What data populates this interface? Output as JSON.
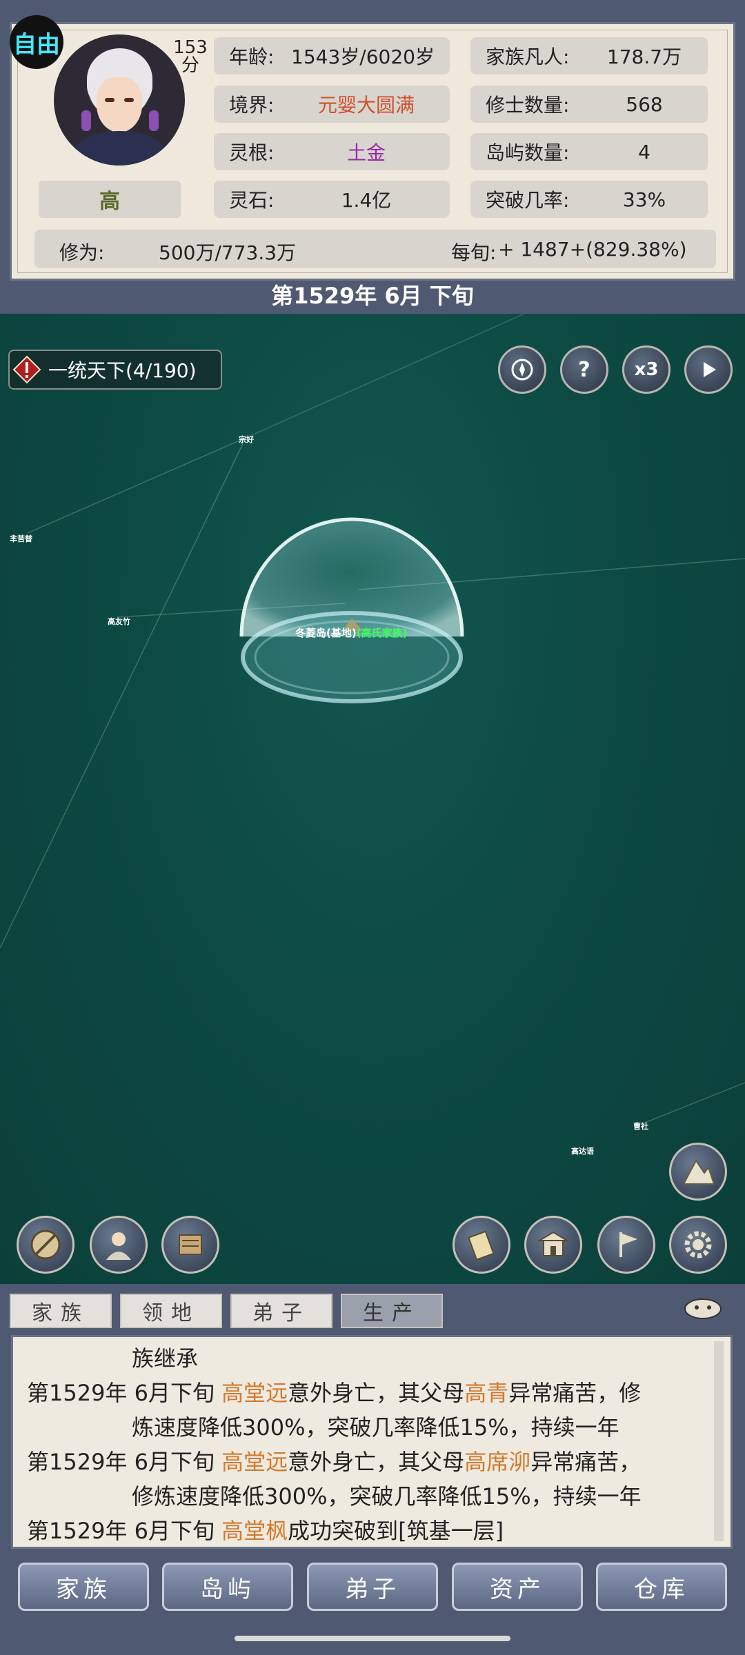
{
  "status": {
    "mode": "自由",
    "score": "153",
    "score_unit": "分",
    "name": "高"
  },
  "stats": {
    "age_label": "年龄:",
    "age_value": "1543岁/6020岁",
    "realm_label": "境界:",
    "realm_value": "元婴大圆满",
    "root_label": "灵根:",
    "root_value": "土金",
    "stones_label": "灵石:",
    "stones_value": "1.4亿",
    "mortals_label": "家族凡人:",
    "mortals_value": "178.7万",
    "cultivators_label": "修士数量:",
    "cultivators_value": "568",
    "islands_label": "岛屿数量:",
    "islands_value": "4",
    "breakthrough_label": "突破几率:",
    "breakthrough_value": "33%",
    "cultivation_label": "修为:",
    "cultivation_value": "500万/773.3万",
    "per_xun_label": "每旬:",
    "per_xun_value": "+ 1487+(829.38%)"
  },
  "date": "第1529年 6月 下旬",
  "map": {
    "quest_label": "一统天下(4/190)",
    "speed_label": "x3",
    "help_label": "?",
    "places": [
      "宗好",
      "芈苦替",
      "高友竹",
      "曹社",
      "高达语"
    ],
    "island_name": "冬菱岛(基地)",
    "island_family": "(高氏家族)"
  },
  "tabs": [
    "家族",
    "领地",
    "弟子",
    "生产"
  ],
  "log": {
    "line0": "族继承",
    "entries": [
      {
        "date": "第1529年 6月下旬",
        "subject": "高堂远",
        "mid": "意外身亡，其父母",
        "target": "高青",
        "rest": "异常痛苦，修",
        "cont": "炼速度降低300%，突破几率降低15%，持续一年"
      },
      {
        "date": "第1529年 6月下旬",
        "subject": "高堂远",
        "mid": "意外身亡，其父母",
        "target": "高席泖",
        "rest": "异常痛苦，",
        "cont": "修炼速度降低300%，突破几率降低15%，持续一年"
      },
      {
        "date": "第1529年 6月下旬",
        "subject": "高堂枫",
        "mid": "成功突破到[筑基一层]",
        "target": "",
        "rest": "",
        "cont": ""
      }
    ]
  },
  "bottom_nav": [
    "家族",
    "岛屿",
    "弟子",
    "资产",
    "仓库"
  ],
  "colors": {
    "realm": "#d0502c",
    "root": "#9b2aa8",
    "name_highlight": "#d4792c",
    "family_green": "#3cff5a"
  }
}
